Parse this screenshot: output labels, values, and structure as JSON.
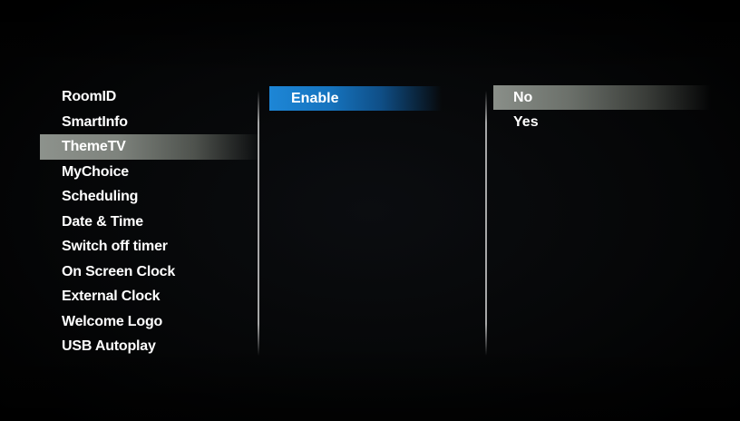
{
  "menu": {
    "items": [
      {
        "label": "RoomID"
      },
      {
        "label": "SmartInfo"
      },
      {
        "label": "ThemeTV"
      },
      {
        "label": "MyChoice"
      },
      {
        "label": "Scheduling"
      },
      {
        "label": "Date & Time"
      },
      {
        "label": "Switch off timer"
      },
      {
        "label": "On Screen Clock"
      },
      {
        "label": "External Clock"
      },
      {
        "label": "Welcome Logo"
      },
      {
        "label": "USB Autoplay"
      }
    ],
    "selected": "ThemeTV"
  },
  "submenu": {
    "items": [
      {
        "label": "Enable"
      }
    ],
    "focused": "Enable"
  },
  "options": {
    "items": [
      {
        "label": "No"
      },
      {
        "label": "Yes"
      }
    ],
    "selected": "No"
  },
  "colors": {
    "background": "#000000",
    "focus_highlight": "#1d86d6",
    "selection_highlight": "#8d928c",
    "text": "#ffffff"
  }
}
